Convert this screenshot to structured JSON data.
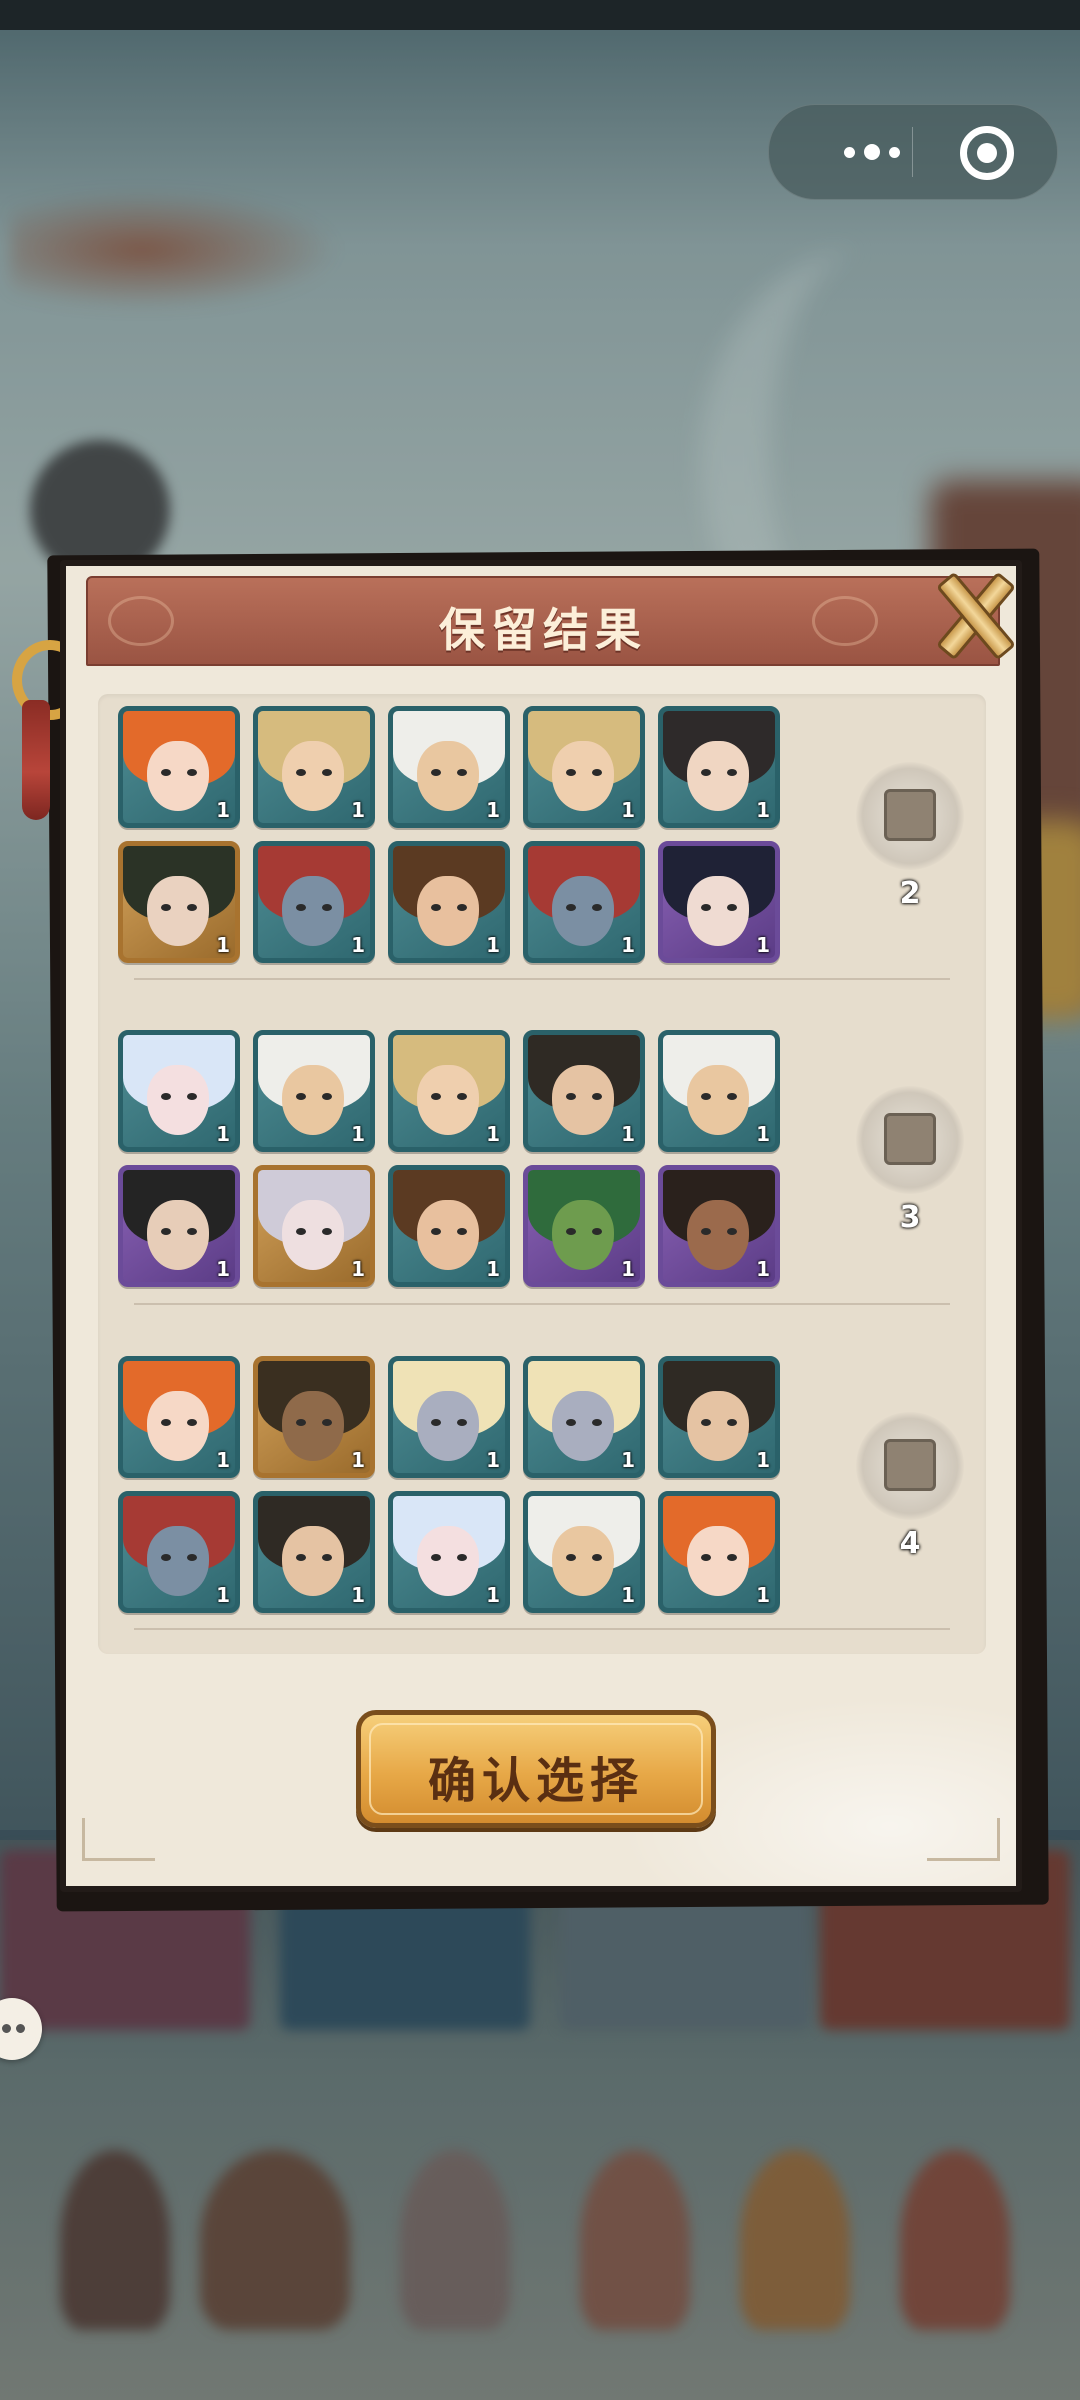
{
  "dialog": {
    "title": "保留结果",
    "confirm_label": "确认选择"
  },
  "groups": [
    {
      "number": "2",
      "heroes": [
        {
          "frame": "teal",
          "hair": "#e36a2a",
          "skin": "#f6d8c6",
          "count": "1"
        },
        {
          "frame": "teal",
          "hair": "#d6bb7e",
          "skin": "#efcfae",
          "count": "1"
        },
        {
          "frame": "teal",
          "hair": "#eeeeea",
          "skin": "#e9c7a0",
          "count": "1"
        },
        {
          "frame": "teal",
          "hair": "#d6bb7e",
          "skin": "#efcfae",
          "count": "1"
        },
        {
          "frame": "teal",
          "hair": "#2e2a2a",
          "skin": "#f0d6c2",
          "count": "1"
        },
        {
          "frame": "gold",
          "hair": "#2b3326",
          "skin": "#ead2c0",
          "count": "1"
        },
        {
          "frame": "teal",
          "hair": "#a63a34",
          "skin": "#7b8fa3",
          "count": "1"
        },
        {
          "frame": "teal",
          "hair": "#5b3a22",
          "skin": "#e8c09e",
          "count": "1"
        },
        {
          "frame": "teal",
          "hair": "#a63a34",
          "skin": "#7b8fa3",
          "count": "1"
        },
        {
          "frame": "purple",
          "hair": "#1f2236",
          "skin": "#efdbd2",
          "count": "1"
        }
      ]
    },
    {
      "number": "3",
      "heroes": [
        {
          "frame": "teal",
          "hair": "#d9e6f7",
          "skin": "#f4dfe0",
          "count": "1"
        },
        {
          "frame": "teal",
          "hair": "#eeeeea",
          "skin": "#e9c7a0",
          "count": "1"
        },
        {
          "frame": "teal",
          "hair": "#d6bb7e",
          "skin": "#efcfae",
          "count": "1"
        },
        {
          "frame": "teal",
          "hair": "#2f2a24",
          "skin": "#e5c3a3",
          "count": "1"
        },
        {
          "frame": "teal",
          "hair": "#eeeeea",
          "skin": "#e9c7a0",
          "count": "1"
        },
        {
          "frame": "purple",
          "hair": "#242424",
          "skin": "#e7cdb8",
          "count": "1"
        },
        {
          "frame": "gold",
          "hair": "#cfcbd8",
          "skin": "#eedfe0",
          "count": "1"
        },
        {
          "frame": "teal",
          "hair": "#5b3a22",
          "skin": "#e8c09e",
          "count": "1"
        },
        {
          "frame": "purple",
          "hair": "#2f6b3c",
          "skin": "#6e9c4e",
          "count": "1"
        },
        {
          "frame": "purple",
          "hair": "#2a211c",
          "skin": "#9b6a4c",
          "count": "1"
        }
      ]
    },
    {
      "number": "4",
      "heroes": [
        {
          "frame": "teal",
          "hair": "#e36a2a",
          "skin": "#f6d8c6",
          "count": "1"
        },
        {
          "frame": "gold",
          "hair": "#3a2f20",
          "skin": "#8f6a4a",
          "count": "1"
        },
        {
          "frame": "teal",
          "hair": "#efe2b6",
          "skin": "#a9aebf",
          "count": "1"
        },
        {
          "frame": "teal",
          "hair": "#efe2b6",
          "skin": "#a9aebf",
          "count": "1"
        },
        {
          "frame": "teal",
          "hair": "#2f2a24",
          "skin": "#e5c3a3",
          "count": "1"
        },
        {
          "frame": "teal",
          "hair": "#a63a34",
          "skin": "#7b8fa3",
          "count": "1"
        },
        {
          "frame": "teal",
          "hair": "#2f2a24",
          "skin": "#e5c3a3",
          "count": "1"
        },
        {
          "frame": "teal",
          "hair": "#d9e6f7",
          "skin": "#f4dfe0",
          "count": "1"
        },
        {
          "frame": "teal",
          "hair": "#eeeeea",
          "skin": "#e9c7a0",
          "count": "1"
        },
        {
          "frame": "teal",
          "hair": "#e36a2a",
          "skin": "#f6d8c6",
          "count": "1"
        }
      ]
    }
  ],
  "capsule": {
    "menu_icon": "more-dots-icon",
    "close_icon": "record-circle-icon"
  },
  "colors": {
    "header": "#9a5443",
    "panel": "#efe8da",
    "confirm": "#e7a847"
  }
}
